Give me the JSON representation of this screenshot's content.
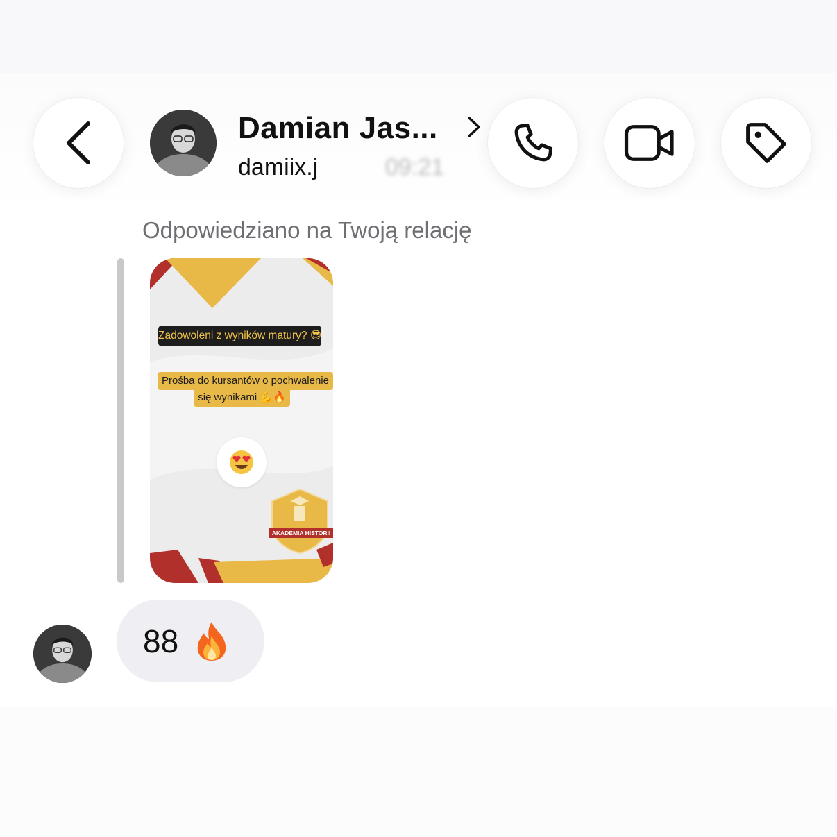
{
  "header": {
    "back_icon": "chevron-left-icon",
    "contact_name": "Damian Jas...",
    "username": "damiix.j",
    "time": "09:21",
    "actions": [
      "phone-icon",
      "video-camera-icon",
      "tag-icon"
    ]
  },
  "thread": {
    "reply_label": "Odpowiedziano na Twoją relację",
    "story": {
      "question": "Zadowoleni z wyników matury? 😎",
      "prompt_line1": "Prośba do kursantów o pochwalenie",
      "prompt_line2": "się wynikami 💪🔥",
      "reaction": "😍",
      "badge_label": "AKADEMIA HISTORII"
    },
    "message": {
      "text": "88",
      "emoji": "🔥"
    }
  },
  "colors": {
    "story_yellow": "#e9b947",
    "story_red": "#b2302b",
    "bubble_bg": "#efeff3",
    "secondary_text": "#6e6e73"
  }
}
